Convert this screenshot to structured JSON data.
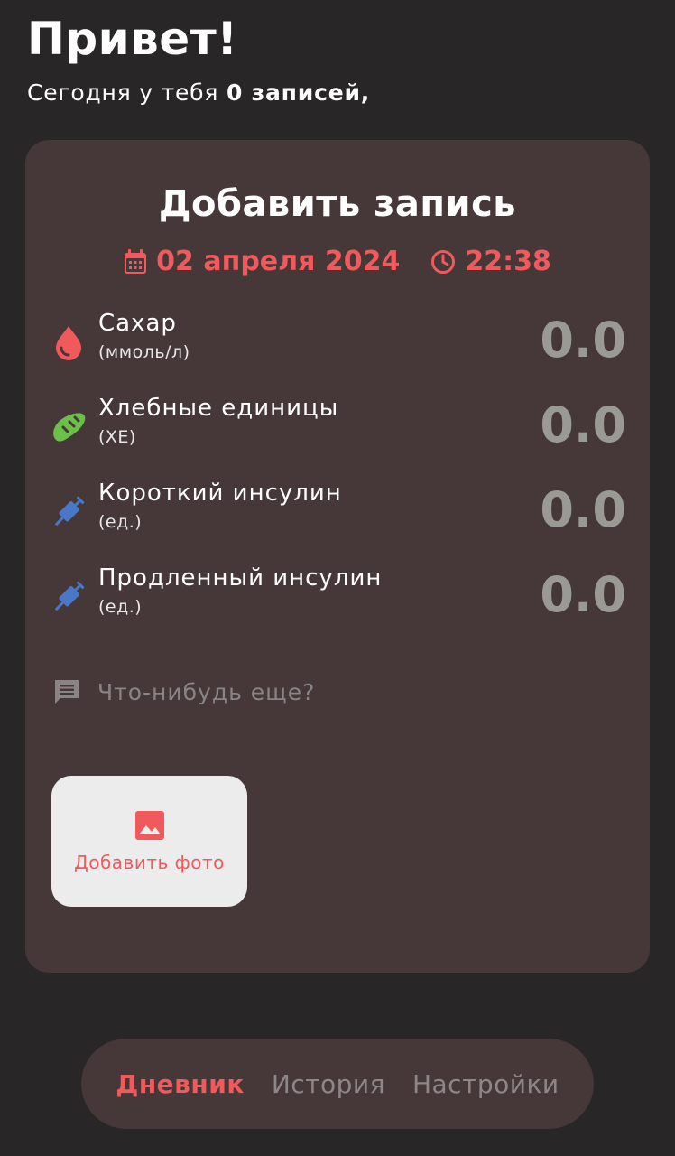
{
  "header": {
    "greeting": "Привет!",
    "subtitle_prefix": "Сегодня у тебя ",
    "subtitle_count": "0 записей,"
  },
  "card": {
    "title": "Добавить запись",
    "date": "02 апреля 2024",
    "time": "22:38",
    "date_icon": "calendar-icon",
    "time_icon": "clock-icon",
    "rows": [
      {
        "label": "Сахар",
        "unit": "(ммоль/л)",
        "value": "0.0",
        "icon": "blood-drop-icon"
      },
      {
        "label": "Хлебные единицы",
        "unit": "(ХЕ)",
        "value": "0.0",
        "icon": "bread-icon"
      },
      {
        "label": "Короткий инсулин",
        "unit": "(ед.)",
        "value": "0.0",
        "icon": "syringe-icon"
      },
      {
        "label": "Продленный инсулин",
        "unit": "(ед.)",
        "value": "0.0",
        "icon": "syringe-icon"
      }
    ],
    "note_placeholder": "Что-нибудь еще?",
    "note_icon": "comment-icon",
    "photo_label": "Добавить фото",
    "photo_icon": "image-icon"
  },
  "nav": {
    "items": [
      {
        "label": "Дневник",
        "active": true
      },
      {
        "label": "История",
        "active": false
      },
      {
        "label": "Настройки",
        "active": false
      }
    ]
  },
  "colors": {
    "background": "#282627",
    "card": "#463838",
    "accent": "#f05a5d",
    "value": "#9a9a94",
    "bread": "#6cc04a",
    "syringe": "#4a78c8"
  }
}
